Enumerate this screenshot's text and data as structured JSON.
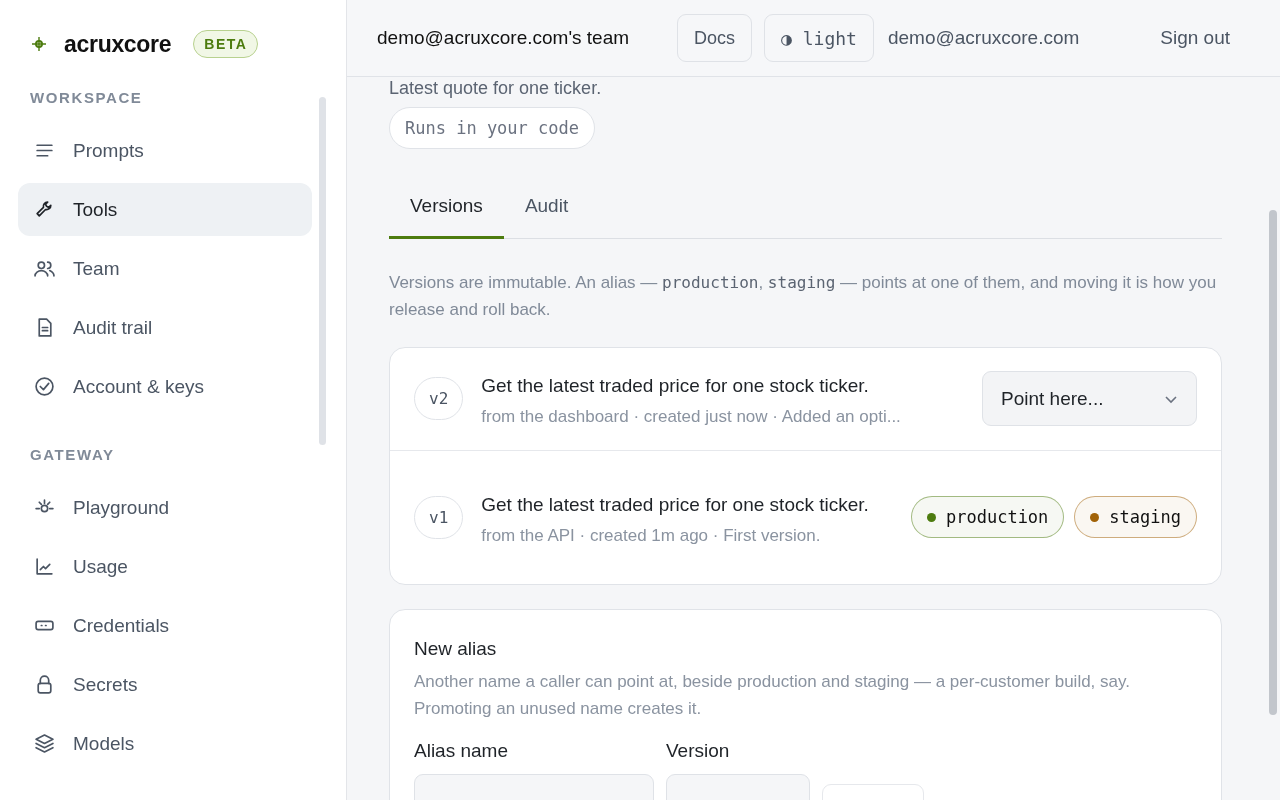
{
  "brand": {
    "name": "acruxcore",
    "badge": "BETA"
  },
  "sidebar": {
    "sections": [
      {
        "heading": "WORKSPACE",
        "items": [
          {
            "label": "Prompts",
            "kind": "lines",
            "selected": false
          },
          {
            "label": "Tools",
            "kind": "wrench",
            "selected": true
          },
          {
            "label": "Team",
            "kind": "people",
            "selected": false
          },
          {
            "label": "Audit trail",
            "kind": "document",
            "selected": false
          },
          {
            "label": "Account & keys",
            "kind": "check-circle",
            "selected": false
          }
        ]
      },
      {
        "heading": "GATEWAY",
        "items": [
          {
            "label": "Playground",
            "kind": "sun",
            "selected": false
          },
          {
            "label": "Usage",
            "kind": "chart",
            "selected": false
          },
          {
            "label": "Credentials",
            "kind": "card",
            "selected": false
          },
          {
            "label": "Secrets",
            "kind": "lock",
            "selected": false
          },
          {
            "label": "Models",
            "kind": "layers",
            "selected": false
          }
        ]
      }
    ]
  },
  "header": {
    "team": "demo@acruxcore.com's team",
    "docs": "Docs",
    "theme": "◑ light",
    "user": "demo@acruxcore.com",
    "sign_out": "Sign out"
  },
  "tool": {
    "description": "Latest quote for one ticker.",
    "runs_badge": "Runs in your code"
  },
  "tabs": [
    {
      "label": "Versions",
      "selected": true
    },
    {
      "label": "Audit",
      "selected": false
    }
  ],
  "versions_note": [
    {
      "text": "Versions are immutable. An alias — ",
      "code": false
    },
    {
      "text": "production",
      "code": true
    },
    {
      "text": ", ",
      "code": false
    },
    {
      "text": "staging",
      "code": true
    },
    {
      "text": " — points at one of them, and moving it is how you release and roll back.",
      "code": false
    }
  ],
  "versions": [
    {
      "tag": "v2",
      "title": "Get the latest traded price for one stock ticker.",
      "meta": "from the dashboard · created just now · Added an opti...",
      "kind": "select",
      "placeholder": "Point here..."
    },
    {
      "tag": "v1",
      "title": "Get the latest traded price for one stock ticker.",
      "meta": "from the API · created 1m ago · First version.",
      "kind": "aliases",
      "aliases": [
        {
          "name": "production",
          "color": "#4d7c0f"
        },
        {
          "name": "staging",
          "color": "#a16207"
        }
      ]
    }
  ],
  "new_alias": {
    "title": "New alias",
    "description": "Another name a caller can point at, beside production and staging — a per-customer build, say. Promoting an unused name creates it.",
    "fields": [
      {
        "label": "Alias name"
      },
      {
        "label": "Version"
      }
    ]
  }
}
